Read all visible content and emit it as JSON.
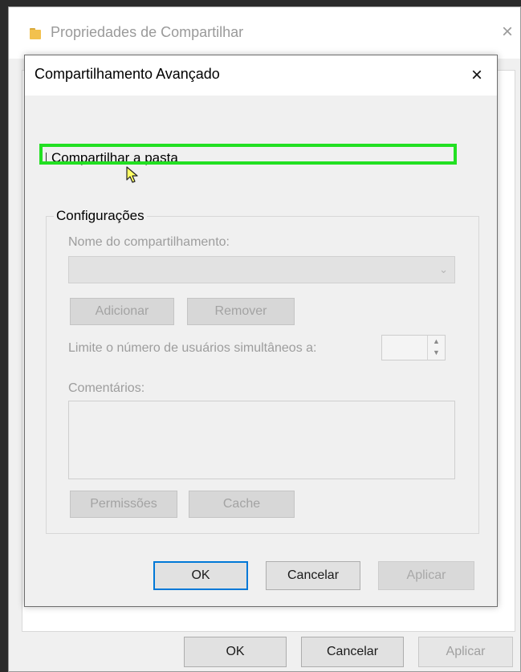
{
  "outer_window": {
    "title": "Propriedades de Compartilhar",
    "close_glyph": "×",
    "buttons": {
      "ok": "OK",
      "cancel": "Cancelar",
      "apply": "Aplicar"
    }
  },
  "dialog": {
    "title": "Compartilhamento Avançado",
    "close_glyph": "×",
    "share_checkbox": {
      "label": "Compartilhar a pasta",
      "checked": false
    },
    "settings": {
      "legend": "Configurações",
      "share_name_label": "Nome do compartilhamento:",
      "share_name_value": "",
      "add_button": "Adicionar",
      "remove_button": "Remover",
      "limit_label": "Limite o número de usuários simultâneos a:",
      "limit_value": "",
      "comments_label": "Comentários:",
      "comments_value": "",
      "permissions_button": "Permissões",
      "cache_button": "Cache"
    },
    "buttons": {
      "ok": "OK",
      "cancel": "Cancelar",
      "apply": "Aplicar"
    }
  },
  "colors": {
    "focus_highlight": "#22e022",
    "default_button_border": "#0078d7",
    "disabled_text": "#9d9d9d"
  },
  "icons": [
    "folder-icon",
    "close-icon",
    "chevron-down-icon",
    "spinner-arrows-icon",
    "mouse-cursor-icon"
  ]
}
